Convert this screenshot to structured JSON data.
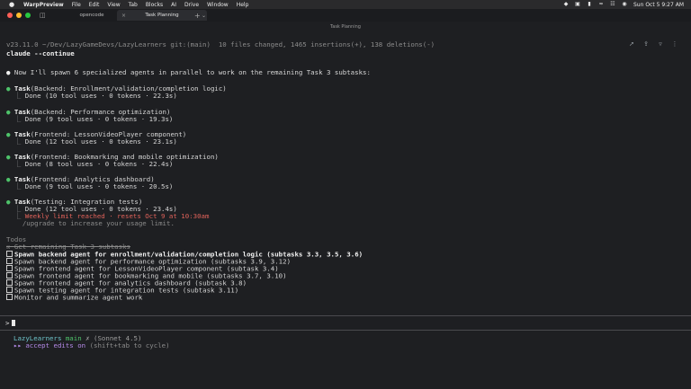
{
  "menubar": {
    "app_name": "WarpPreview",
    "menus": [
      "File",
      "Edit",
      "View",
      "Tab",
      "Blocks",
      "AI",
      "Drive",
      "Window",
      "Help"
    ],
    "datetime": "Sun Oct 5  9:27 AM"
  },
  "tabs": [
    {
      "label": "opencode",
      "active": false
    },
    {
      "label": "Task Planning",
      "active": true
    }
  ],
  "pane": {
    "title": "Task Planning"
  },
  "terminal": {
    "prompt_context": "v23.11.0 ~/Dev/LazyGameDevs/LazyLearners git:(main)  10 files changed, 1465 insertions(+), 138 deletions(-)",
    "command": "claude --continue",
    "intro": "Now I'll spawn 6 specialized agents in parallel to work on the remaining Task 3 subtasks:",
    "tasks": [
      {
        "title": "Task",
        "detail": "(Backend: Enrollment/validation/completion logic)",
        "result": "Done (10 tool uses · 0 tokens · 22.3s)"
      },
      {
        "title": "Task",
        "detail": "(Backend: Performance optimization)",
        "result": "Done (9 tool uses · 0 tokens · 19.3s)"
      },
      {
        "title": "Task",
        "detail": "(Frontend: LessonVideoPlayer component)",
        "result": "Done (12 tool uses · 0 tokens · 23.1s)"
      },
      {
        "title": "Task",
        "detail": "(Frontend: Bookmarking and mobile optimization)",
        "result": "Done (8 tool uses · 0 tokens · 22.4s)"
      },
      {
        "title": "Task",
        "detail": "(Frontend: Analytics dashboard)",
        "result": "Done (9 tool uses · 0 tokens · 20.5s)"
      },
      {
        "title": "Task",
        "detail": "(Testing: Integration tests)",
        "result": "Done (12 tool uses · 0 tokens · 23.4s)"
      }
    ],
    "limit_message": "Weekly limit reached · resets Oct 9 at 10:30am",
    "upgrade_message": "/upgrade to increase your usage limit.",
    "todos_header": "Todos",
    "todos": [
      {
        "text": "Get remaining Task 3 subtasks",
        "done": true,
        "bold": false
      },
      {
        "text": "Spawn backend agent for enrollment/validation/completion logic (subtasks 3.3, 3.5, 3.6)",
        "done": false,
        "bold": true
      },
      {
        "text": "Spawn backend agent for performance optimization (subtasks 3.9, 3.12)",
        "done": false,
        "bold": false
      },
      {
        "text": "Spawn frontend agent for LessonVideoPlayer component (subtask 3.4)",
        "done": false,
        "bold": false
      },
      {
        "text": "Spawn frontend agent for bookmarking and mobile (subtasks 3.7, 3.10)",
        "done": false,
        "bold": false
      },
      {
        "text": "Spawn frontend agent for analytics dashboard (subtask 3.8)",
        "done": false,
        "bold": false
      },
      {
        "text": "Spawn testing agent for integration tests (subtask 3.11)",
        "done": false,
        "bold": false
      },
      {
        "text": "Monitor and summarize agent work",
        "done": false,
        "bold": false
      }
    ],
    "input_prompt": ">",
    "status_repo": "LazyLearners",
    "status_branch": "main",
    "status_model": "(Sonnet 4.5)",
    "accept_label": "accept edits on",
    "accept_hint": "(shift+tab to cycle)"
  },
  "icons": {
    "menubar": [
      "apple-icon",
      "dropbox-icon",
      "display-icon",
      "battery-icon",
      "wifi-icon",
      "control-center-icon",
      "user-icon"
    ],
    "toolbar": [
      "pin-icon",
      "share-icon",
      "filter-icon",
      "more-icon"
    ]
  }
}
